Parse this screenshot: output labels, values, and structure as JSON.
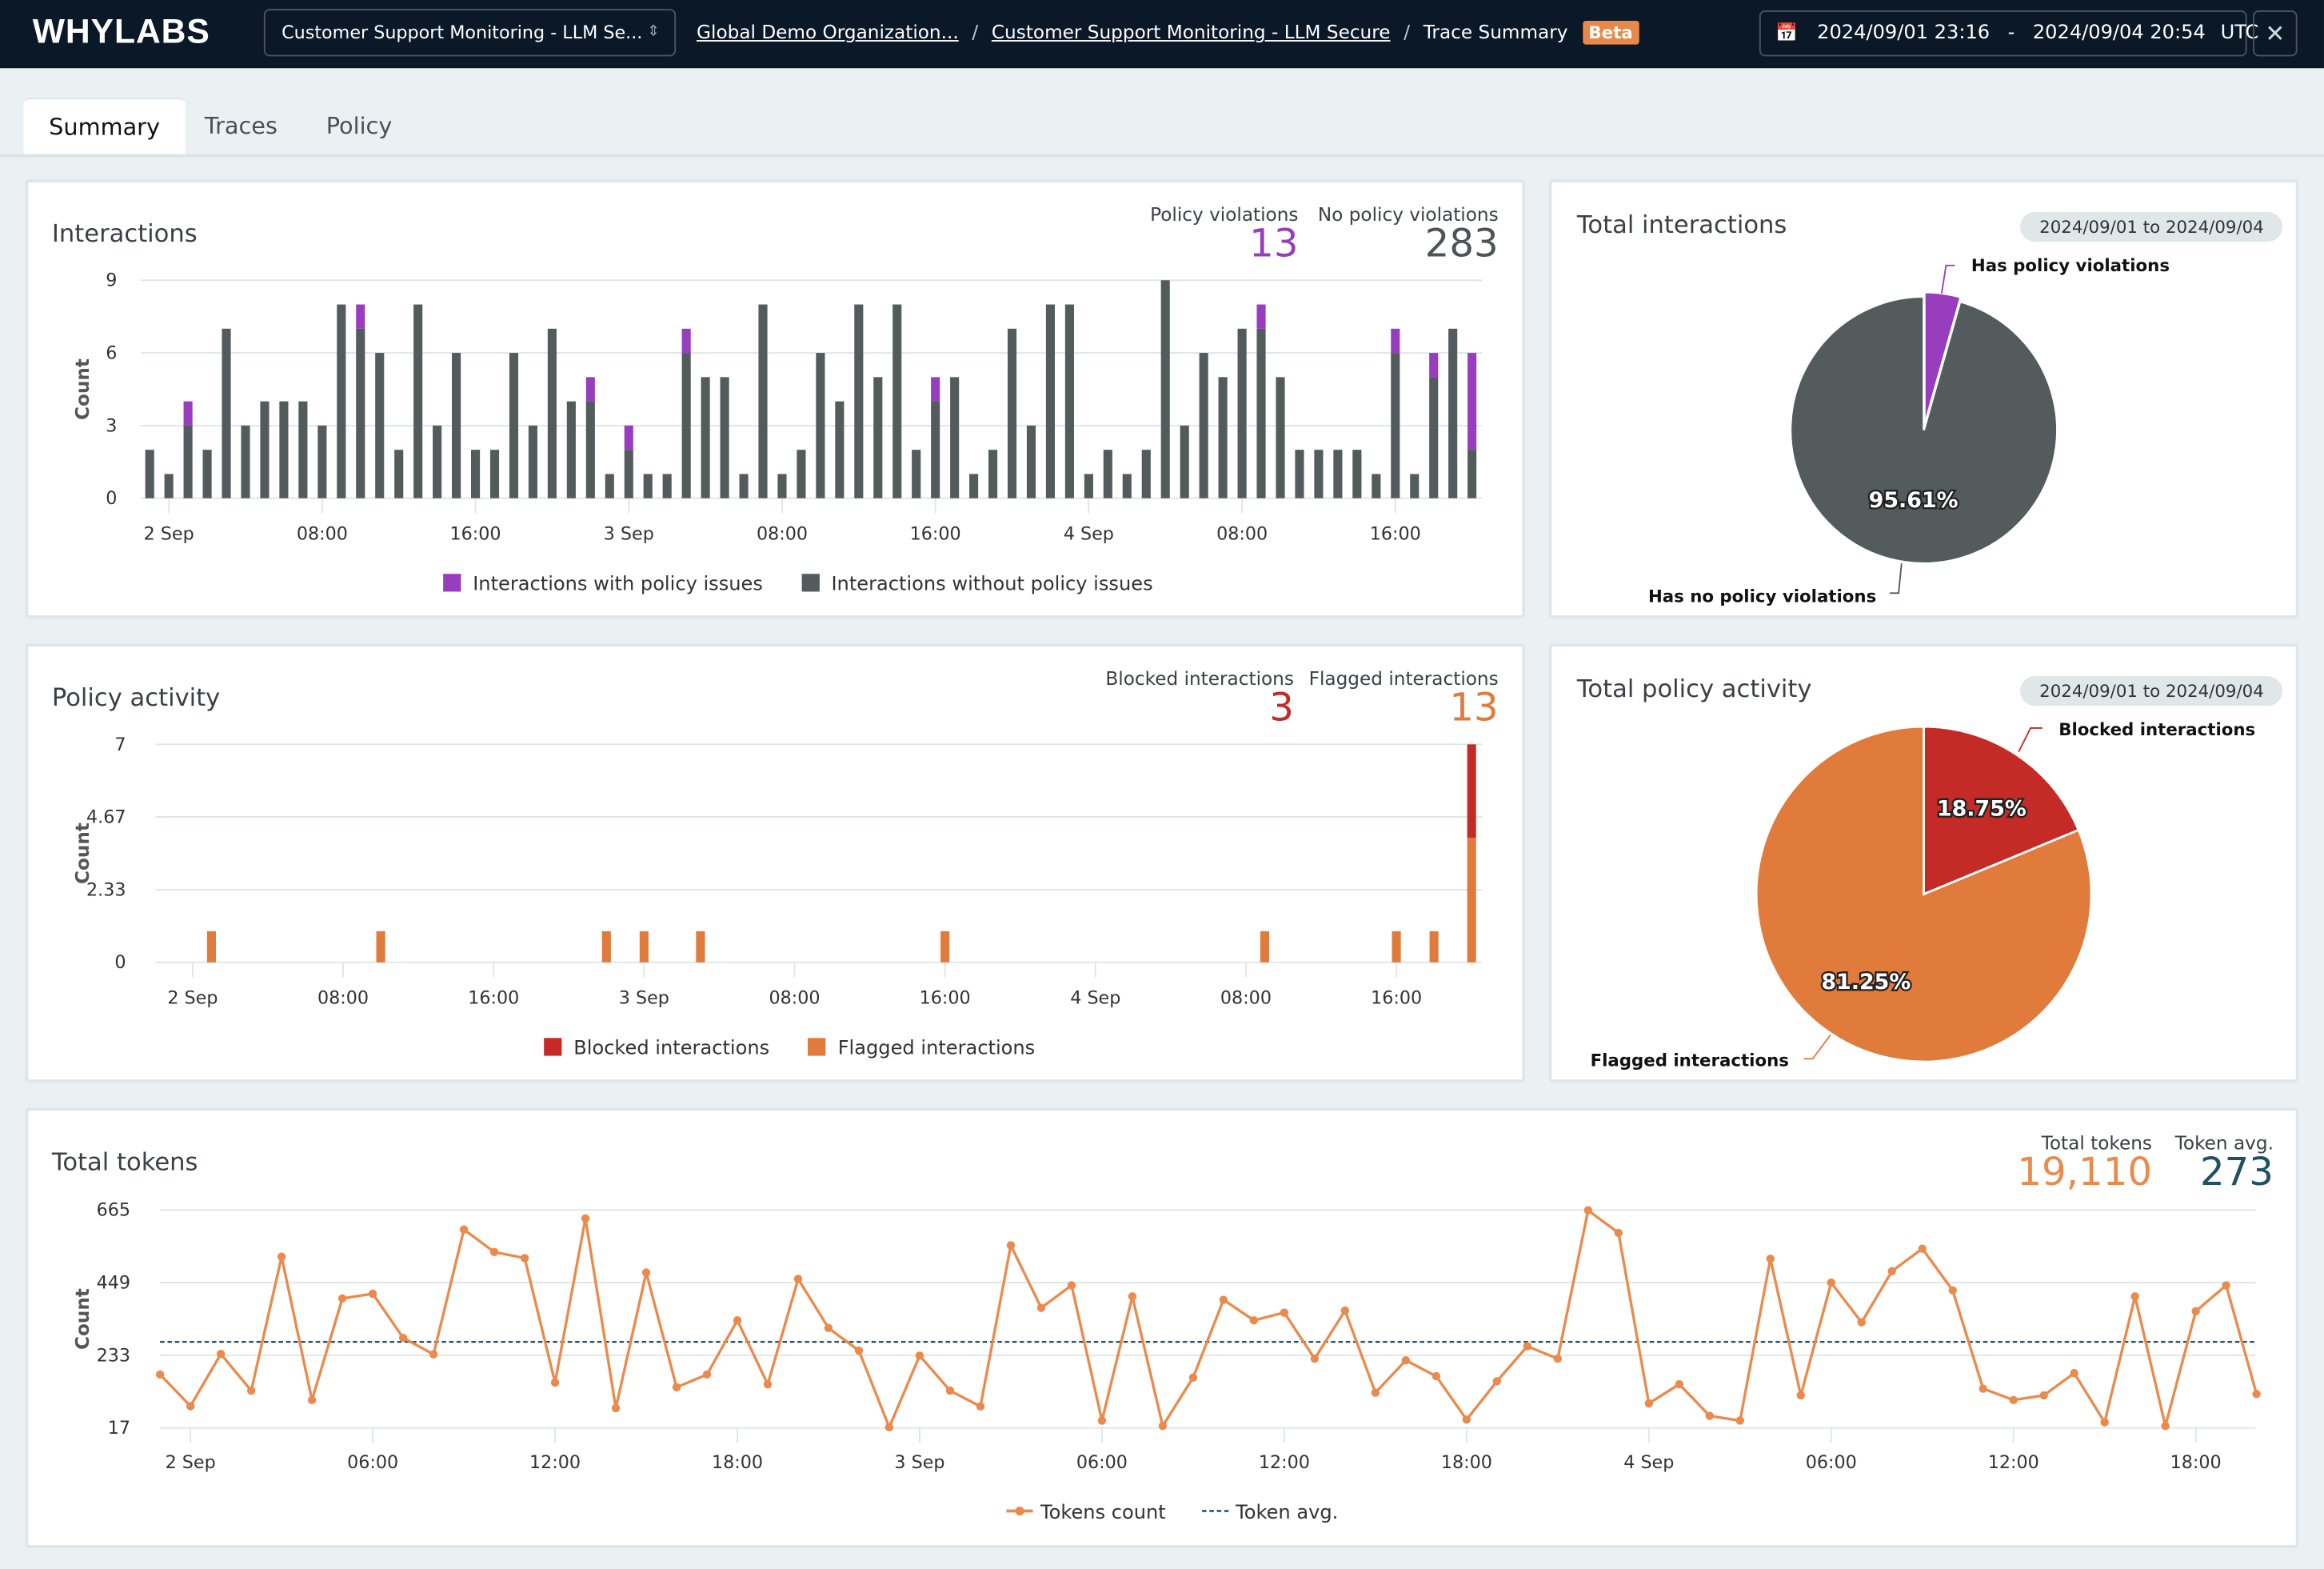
{
  "header": {
    "logo": "WHYLABS",
    "resource_select": "Customer Support Monitoring - LLM Se...",
    "breadcrumbs": [
      "Global Demo Organization...",
      "Customer Support Monitoring - LLM Secure",
      "Trace Summary"
    ],
    "beta_badge": "Beta",
    "date_range": {
      "start": "2024/09/01 23:16",
      "separator": "-",
      "end": "2024/09/04 20:54",
      "timezone": "UTC"
    },
    "icons": {
      "select": "chevron-up-down-icon",
      "calendar": "calendar-icon",
      "close": "close-icon"
    }
  },
  "tabs": [
    {
      "label": "Summary",
      "active": true
    },
    {
      "label": "Traces",
      "active": false
    },
    {
      "label": "Policy",
      "active": false
    }
  ],
  "colors": {
    "violation": "#993dbf",
    "no_violation": "#535b5d",
    "blocked": "#c42b26",
    "flagged": "#e07b3c",
    "tokens": "#ea8a4c",
    "token_avg": "#1f5163"
  },
  "interactions_card": {
    "title": "Interactions",
    "stats": [
      {
        "label": "Policy violations",
        "value": "13",
        "color": "#993dbf"
      },
      {
        "label": "No policy violations",
        "value": "283",
        "color": "#4d5457"
      }
    ],
    "legend": [
      "Interactions with policy issues",
      "Interactions without policy issues"
    ]
  },
  "total_interactions_card": {
    "title": "Total interactions",
    "date_pill": "2024/09/01 to 2024/09/04"
  },
  "policy_activity_card": {
    "title": "Policy activity",
    "stats": [
      {
        "label": "Blocked interactions",
        "value": "3",
        "color": "#c42b26"
      },
      {
        "label": "Flagged interactions",
        "value": "13",
        "color": "#e07b3c"
      }
    ],
    "legend": [
      "Blocked interactions",
      "Flagged interactions"
    ]
  },
  "total_policy_card": {
    "title": "Total policy activity",
    "date_pill": "2024/09/01 to 2024/09/04"
  },
  "tokens_card": {
    "title": "Total tokens",
    "stats": [
      {
        "label": "Total tokens",
        "value": "19,110",
        "color": "#ea8a4c"
      },
      {
        "label": "Token avg.",
        "value": "273",
        "color": "#1f5163"
      }
    ],
    "legend": [
      "Tokens count",
      "Token avg."
    ]
  },
  "chart_data": [
    {
      "id": "interactions",
      "type": "bar",
      "stacked": true,
      "ylabel": "Count",
      "ylim": [
        0,
        9
      ],
      "yticks": [
        "0",
        "3",
        "6",
        "9"
      ],
      "xlim": [
        "2024-09-01T23:00",
        "2024-09-04T20:00"
      ],
      "xticks": [
        {
          "t": "2024-09-02T00:00",
          "label": "2 Sep"
        },
        {
          "t": "2024-09-02T08:00",
          "label": "08:00"
        },
        {
          "t": "2024-09-02T16:00",
          "label": "16:00"
        },
        {
          "t": "2024-09-03T00:00",
          "label": "3 Sep"
        },
        {
          "t": "2024-09-03T08:00",
          "label": "08:00"
        },
        {
          "t": "2024-09-03T16:00",
          "label": "16:00"
        },
        {
          "t": "2024-09-04T00:00",
          "label": "4 Sep"
        },
        {
          "t": "2024-09-04T08:00",
          "label": "08:00"
        },
        {
          "t": "2024-09-04T16:00",
          "label": "16:00"
        }
      ],
      "grid": true,
      "legend": "bottom",
      "x_start": "2024-09-01T23:00",
      "x_interval": "1 hour",
      "series": [
        {
          "name": "Interactions without policy issues",
          "color": "#535b5d",
          "values": [
            2,
            1,
            3,
            2,
            7,
            3,
            4,
            4,
            4,
            3,
            8,
            7,
            6,
            2,
            8,
            3,
            6,
            2,
            2,
            6,
            3,
            7,
            4,
            4,
            1,
            2,
            1,
            1,
            6,
            5,
            5,
            1,
            8,
            1,
            2,
            6,
            4,
            8,
            5,
            8,
            2,
            4,
            5,
            1,
            2,
            7,
            3,
            8,
            8,
            1,
            2,
            1,
            2,
            9,
            3,
            6,
            5,
            7,
            7,
            5,
            2,
            2,
            2,
            2,
            1,
            6,
            1,
            5,
            7,
            2
          ]
        },
        {
          "name": "Interactions with policy issues",
          "color": "#993dbf",
          "values": [
            0,
            0,
            1,
            0,
            0,
            0,
            0,
            0,
            0,
            0,
            0,
            1,
            0,
            0,
            0,
            0,
            0,
            0,
            0,
            0,
            0,
            0,
            0,
            1,
            0,
            1,
            0,
            0,
            1,
            0,
            0,
            0,
            0,
            0,
            0,
            0,
            0,
            0,
            0,
            0,
            0,
            1,
            0,
            0,
            0,
            0,
            0,
            0,
            0,
            0,
            0,
            0,
            0,
            0,
            0,
            0,
            0,
            0,
            1,
            0,
            0,
            0,
            0,
            0,
            0,
            1,
            0,
            1,
            0,
            4
          ]
        }
      ]
    },
    {
      "id": "total_interactions",
      "type": "pie",
      "slices": [
        {
          "label": "Has policy violations",
          "value": 4.39,
          "color": "#993dbf"
        },
        {
          "label": "Has no policy violations",
          "value": 95.61,
          "display": "95.61%",
          "color": "#535b5d"
        }
      ]
    },
    {
      "id": "policy_activity",
      "type": "bar",
      "stacked": true,
      "ylabel": "Count",
      "ylim": [
        0,
        7
      ],
      "yticks": [
        "0",
        "2.33",
        "4.67",
        "7"
      ],
      "xlim": [
        "2024-09-01T23:00",
        "2024-09-04T20:00"
      ],
      "xticks": [
        {
          "t": "2024-09-02T00:00",
          "label": "2 Sep"
        },
        {
          "t": "2024-09-02T08:00",
          "label": "08:00"
        },
        {
          "t": "2024-09-02T16:00",
          "label": "16:00"
        },
        {
          "t": "2024-09-03T00:00",
          "label": "3 Sep"
        },
        {
          "t": "2024-09-03T08:00",
          "label": "08:00"
        },
        {
          "t": "2024-09-03T16:00",
          "label": "16:00"
        },
        {
          "t": "2024-09-04T00:00",
          "label": "4 Sep"
        },
        {
          "t": "2024-09-04T08:00",
          "label": "08:00"
        },
        {
          "t": "2024-09-04T16:00",
          "label": "16:00"
        }
      ],
      "grid": true,
      "legend": "bottom",
      "x": [
        "2024-09-02T01:00",
        "2024-09-02T10:00",
        "2024-09-02T22:00",
        "2024-09-03T00:00",
        "2024-09-03T03:00",
        "2024-09-03T16:00",
        "2024-09-04T09:00",
        "2024-09-04T16:00",
        "2024-09-04T18:00",
        "2024-09-04T20:00"
      ],
      "series": [
        {
          "name": "Flagged interactions",
          "color": "#e07b3c",
          "values": [
            1,
            1,
            1,
            1,
            1,
            1,
            1,
            1,
            1,
            4
          ]
        },
        {
          "name": "Blocked interactions",
          "color": "#c42b26",
          "values": [
            0,
            0,
            0,
            0,
            0,
            0,
            0,
            0,
            0,
            3
          ]
        }
      ]
    },
    {
      "id": "total_policy_activity",
      "type": "pie",
      "slices": [
        {
          "label": "Blocked interactions",
          "value": 18.75,
          "display": "18.75%",
          "color": "#c42b26"
        },
        {
          "label": "Flagged interactions",
          "value": 81.25,
          "display": "81.25%",
          "color": "#e07b3c"
        }
      ]
    },
    {
      "id": "tokens",
      "type": "line",
      "ylabel": "Count",
      "ylim": [
        17,
        665
      ],
      "yticks": [
        "17",
        "233",
        "449",
        "665"
      ],
      "xlim": [
        "2024-09-01T23:00",
        "2024-09-04T20:00"
      ],
      "xticks": [
        {
          "t": "2024-09-02T00:00",
          "label": "2 Sep"
        },
        {
          "t": "2024-09-02T06:00",
          "label": "06:00"
        },
        {
          "t": "2024-09-02T12:00",
          "label": "12:00"
        },
        {
          "t": "2024-09-02T18:00",
          "label": "18:00"
        },
        {
          "t": "2024-09-03T00:00",
          "label": "3 Sep"
        },
        {
          "t": "2024-09-03T06:00",
          "label": "06:00"
        },
        {
          "t": "2024-09-03T12:00",
          "label": "12:00"
        },
        {
          "t": "2024-09-03T18:00",
          "label": "18:00"
        },
        {
          "t": "2024-09-04T00:00",
          "label": "4 Sep"
        },
        {
          "t": "2024-09-04T06:00",
          "label": "06:00"
        },
        {
          "t": "2024-09-04T12:00",
          "label": "12:00"
        },
        {
          "t": "2024-09-04T18:00",
          "label": "18:00"
        }
      ],
      "grid": true,
      "legend": "bottom",
      "x_start": "2024-09-01T23:00",
      "x_interval": "1 hour",
      "series": [
        {
          "name": "Tokens count",
          "color": "#ea8a4c",
          "values": [
            176,
            82,
            237,
            128,
            526,
            100,
            402,
            416,
            285,
            236,
            607,
            540,
            522,
            152,
            640,
            76,
            479,
            138,
            176,
            337,
            147,
            460,
            314,
            247,
            19,
            232,
            128,
            81,
            560,
            374,
            441,
            39,
            408,
            23,
            167,
            398,
            337,
            360,
            223,
            366,
            122,
            218,
            171,
            42,
            156,
            260,
            223,
            664,
            597,
            90,
            147,
            53,
            39,
            520,
            114,
            449,
            331,
            483,
            550,
            426,
            134,
            100,
            114,
            180,
            34,
            408,
            23,
            364,
            441,
            118
          ]
        },
        {
          "name": "Token avg.",
          "color": "#1f5163",
          "value": 273,
          "style": "dashed"
        }
      ]
    }
  ]
}
